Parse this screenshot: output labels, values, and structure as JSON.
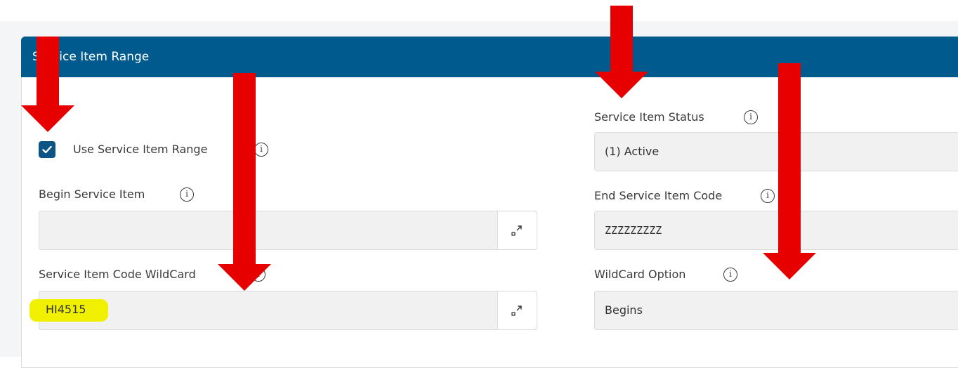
{
  "panel": {
    "title": "Service Item Range"
  },
  "use_range": {
    "label": "Use Service Item Range",
    "checked": true
  },
  "fields": {
    "begin_item": {
      "label": "Begin Service Item",
      "value": ""
    },
    "wildcard_code": {
      "label": "Service Item Code WildCard",
      "value": "HI4515"
    },
    "status": {
      "label": "Service Item Status",
      "value": "(1) Active"
    },
    "end_code": {
      "label": "End Service Item Code",
      "value": "ZZZZZZZZZ"
    },
    "wildcard_option": {
      "label": "WildCard Option",
      "value": "Begins"
    }
  },
  "icons": {
    "info": "info-icon",
    "info_glyph": "i",
    "expand": "expand-icon",
    "check": "check-icon"
  },
  "colors": {
    "header": "#005a8e",
    "checkbox": "#0a5585",
    "annotation_arrow": "#e60000",
    "highlight": "#f0f000"
  }
}
